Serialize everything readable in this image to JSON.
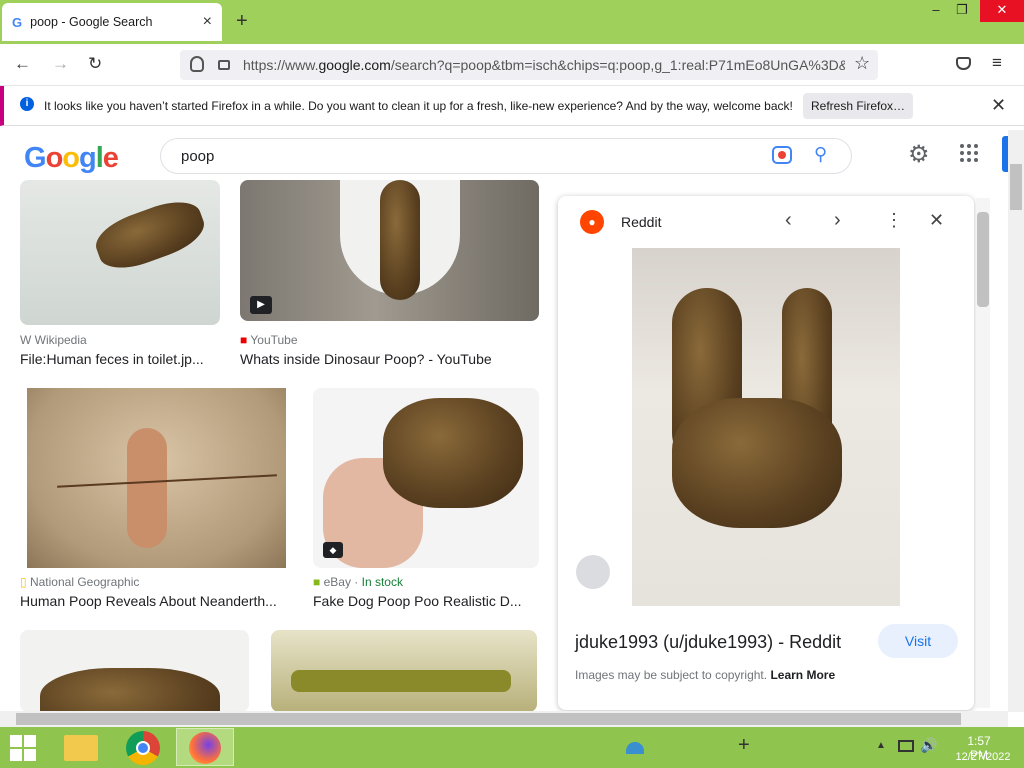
{
  "browser": {
    "tab_title": "poop - Google Search",
    "tab_icon": "G",
    "url_prefix": "https://www.",
    "url_domain": "google.com",
    "url_rest": "/search?q=poop&tbm=isch&chips=q:poop,g_1:real:P71mEo8UnGA%3D&",
    "window_controls": {
      "minimize": "–",
      "maximize": "❐",
      "close": "✕"
    }
  },
  "notification": {
    "text": "It looks like you haven’t started Firefox in a while. Do you want to clean it up for a fresh, like-new experience? And by the way, welcome back!",
    "button": "Refresh Firefox…"
  },
  "search": {
    "query": "poop"
  },
  "results": [
    {
      "source": "Wikipedia",
      "title": "File:Human feces in toilet.jp..."
    },
    {
      "source": "YouTube",
      "title": "Whats inside Dinosaur Poop? - YouTube"
    },
    {
      "source": "National Geographic",
      "title": "Human Poop Reveals About Neanderth..."
    },
    {
      "source": "eBay",
      "stock": "In stock",
      "title": "Fake Dog Poop Poo Realistic D..."
    }
  ],
  "panel": {
    "site": "Reddit",
    "title": "jduke1993 (u/jduke1993) - Reddit",
    "visit": "Visit",
    "copyright": "Images may be subject to copyright.",
    "learn_more": "Learn More"
  },
  "taskbar": {
    "time": "1:57 PM",
    "date": "12/27/2022"
  },
  "colors": {
    "tabbar": "#9fd05b",
    "taskbar": "#8fc44e",
    "accent": "#1a73e8"
  }
}
